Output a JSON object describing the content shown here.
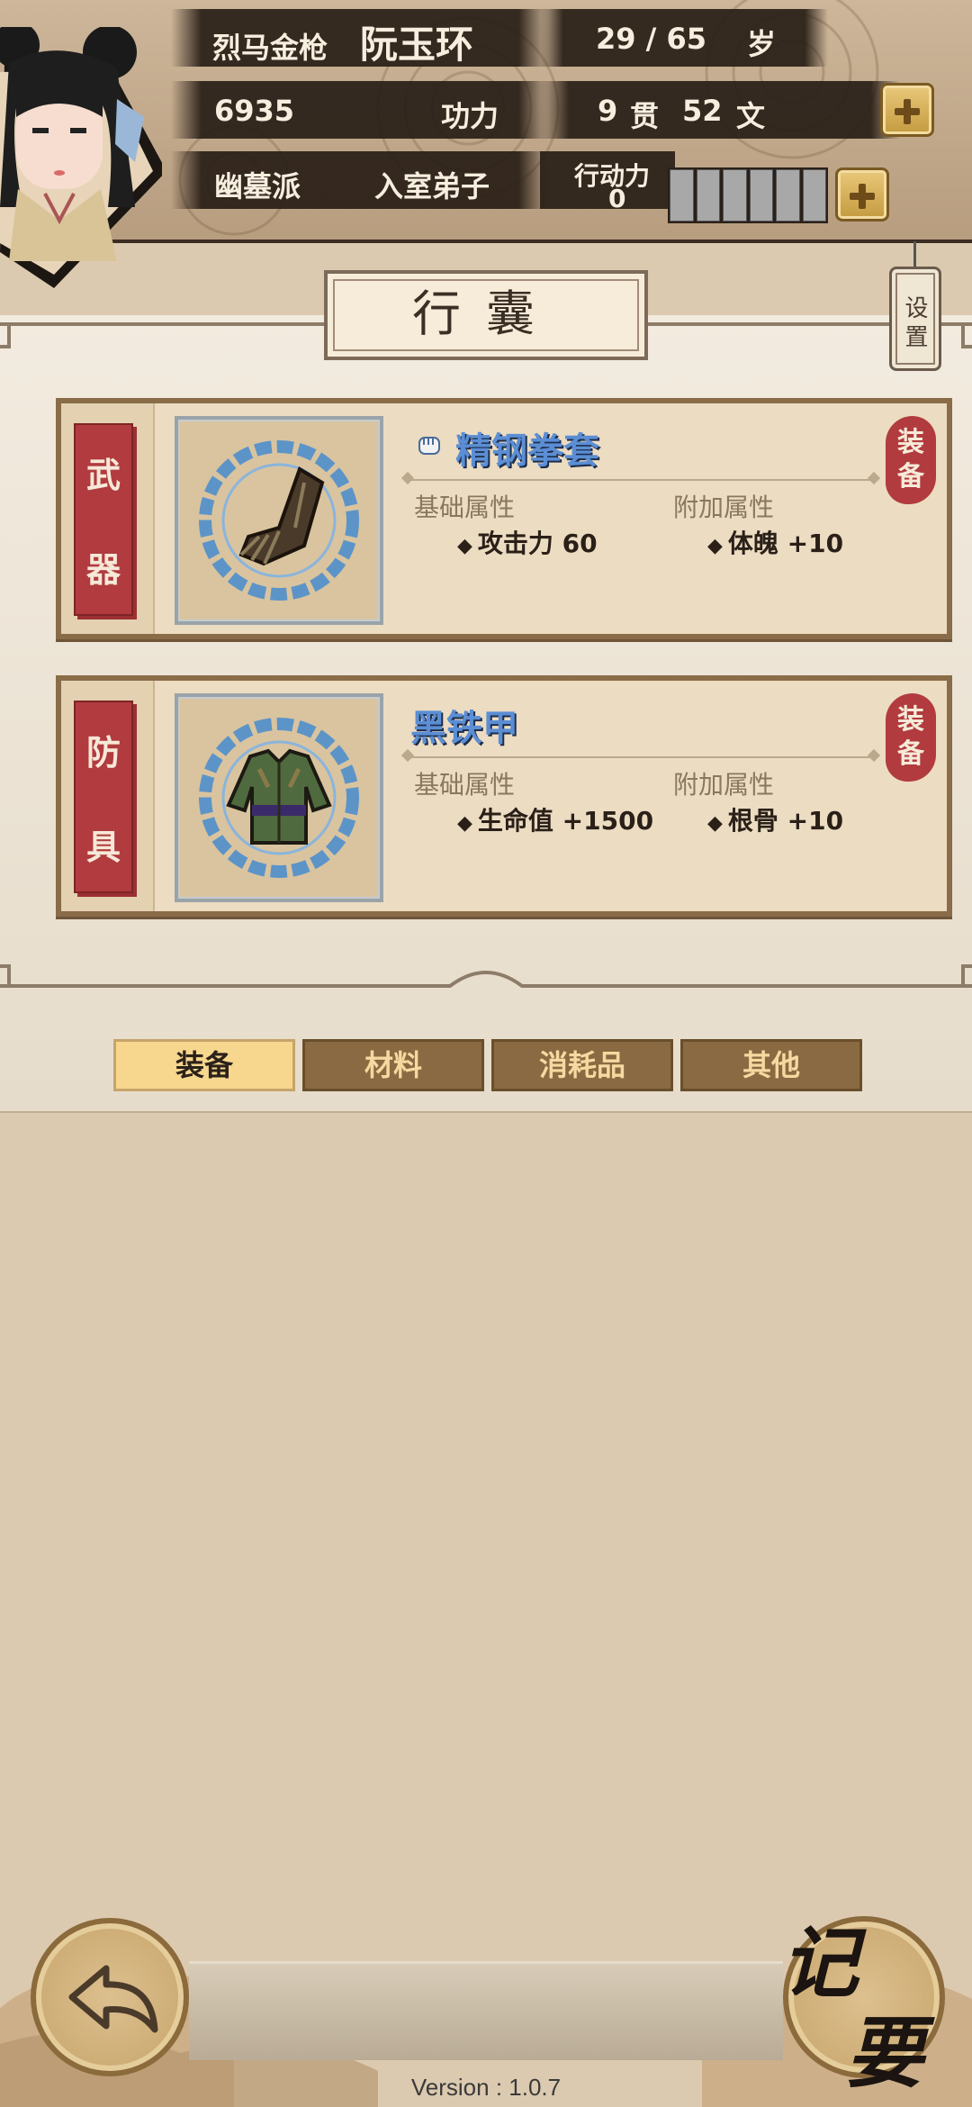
{
  "header": {
    "nickname": "烈马金枪",
    "name": "阮玉环",
    "age": "29 / 65",
    "age_unit": "岁",
    "power_value": "6935",
    "power_label": "功力",
    "money_guan": "9",
    "money_guan_unit": "贯",
    "money_wen": "52",
    "money_wen_unit": "文",
    "sect": "幽墓派",
    "rank": "入室弟子",
    "stamina_label": "行动力",
    "stamina_value": "0"
  },
  "panel": {
    "title": "行囊",
    "settings_label": "设置"
  },
  "items": [
    {
      "slot_label_top": "武",
      "slot_label_bottom": "器",
      "name": "精钢拳套",
      "icon": "gauntlet-icon",
      "base_attr_label": "基础属性",
      "base_attr": "攻击力 60",
      "extra_attr_label": "附加属性",
      "extra_attr": "体魄 +10",
      "action_top": "装",
      "action_bottom": "备"
    },
    {
      "slot_label_top": "防",
      "slot_label_bottom": "具",
      "name": "黑铁甲",
      "icon": "armor-icon",
      "base_attr_label": "基础属性",
      "base_attr": "生命值 +1500",
      "extra_attr_label": "附加属性",
      "extra_attr": "根骨 +10",
      "action_top": "装",
      "action_bottom": "备"
    }
  ],
  "tabs": [
    "装备",
    "材料",
    "消耗品",
    "其他"
  ],
  "active_tab": "装备",
  "footer": {
    "notes_char1": "记",
    "notes_char2": "要",
    "version": "Version : 1.0.7"
  },
  "colors": {
    "accent_red": "#b13b3e",
    "item_name_blue": "#5b8ed4",
    "tab_active": "#f7d68e",
    "tab_inactive": "#8a6a42"
  }
}
